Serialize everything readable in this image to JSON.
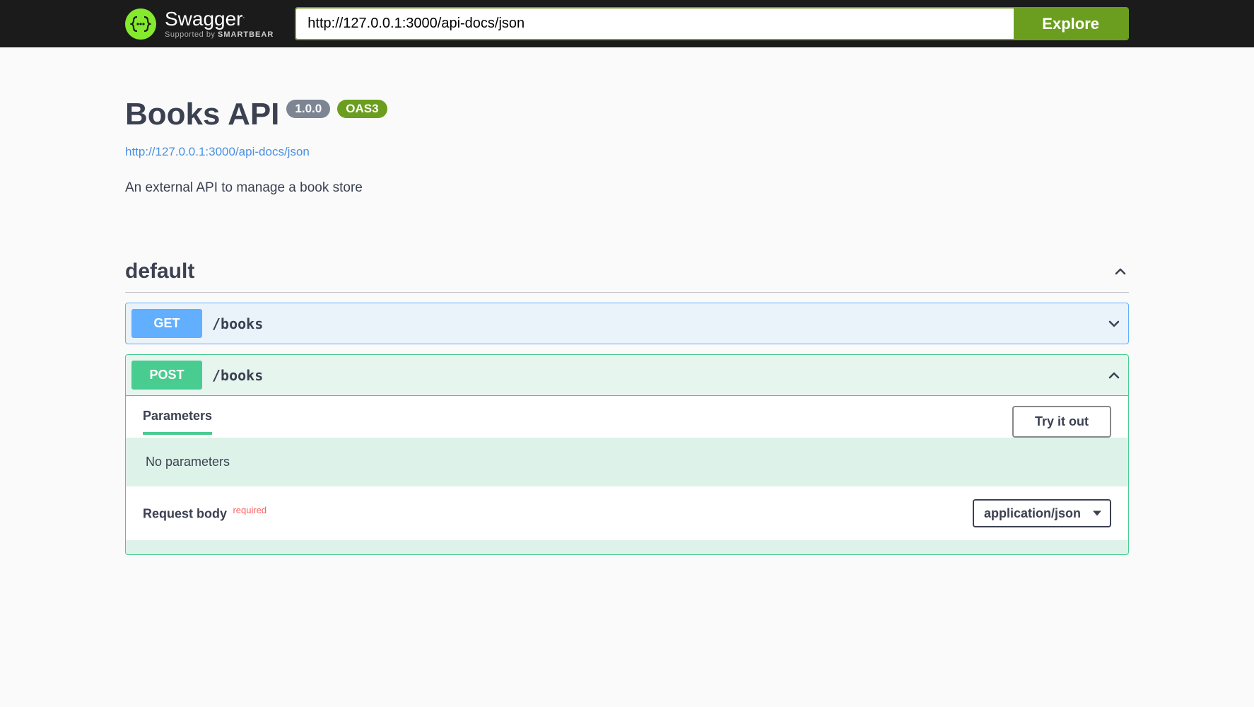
{
  "topbar": {
    "brand": "Swagger",
    "supported_prefix": "Supported by ",
    "supported_brand": "SMARTBEAR",
    "url_value": "http://127.0.0.1:3000/api-docs/json",
    "explore_label": "Explore"
  },
  "info": {
    "title": "Books API",
    "version": "1.0.0",
    "oas_badge": "OAS3",
    "spec_url": "http://127.0.0.1:3000/api-docs/json",
    "description": "An external API to manage a book store"
  },
  "tag": {
    "name": "default"
  },
  "operations": [
    {
      "method": "GET",
      "path": "/books",
      "expanded": false
    },
    {
      "method": "POST",
      "path": "/books",
      "expanded": true,
      "parameters_tab": "Parameters",
      "try_label": "Try it out",
      "no_params_text": "No parameters",
      "request_body_label": "Request body",
      "required_label": "required",
      "content_type_selected": "application/json"
    }
  ]
}
